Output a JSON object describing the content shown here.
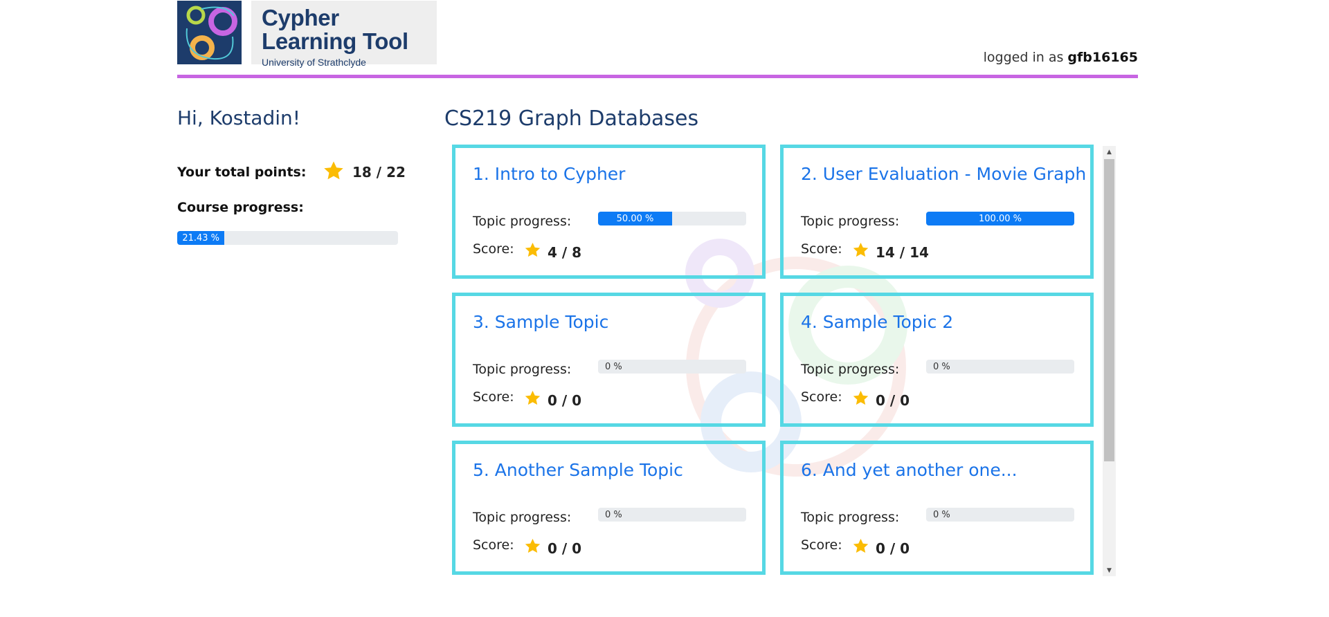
{
  "header": {
    "logo_title_line1": "Cypher",
    "logo_title_line2": "Learning Tool",
    "logo_subtitle": "University of Strathclyde",
    "login_prefix": "logged in as",
    "username": "gfb16165"
  },
  "sidebar": {
    "greeting": "Hi, Kostadin!",
    "points_label": "Your total points:",
    "points_value": "18 / 22",
    "progress_label": "Course progress:",
    "course_progress_percent": 21.43,
    "course_progress_text": "21.43 %"
  },
  "course": {
    "title": "CS219 Graph Databases",
    "topics": [
      {
        "title": "1. Intro to Cypher",
        "progress_label": "Topic progress:",
        "progress_percent": 50,
        "progress_text": "50.00 %",
        "score_label": "Score:",
        "score": "4 / 8"
      },
      {
        "title": "2. User Evaluation - Movie Graph",
        "progress_label": "Topic progress:",
        "progress_percent": 100,
        "progress_text": "100.00 %",
        "score_label": "Score:",
        "score": "14 / 14"
      },
      {
        "title": "3. Sample Topic",
        "progress_label": "Topic progress:",
        "progress_percent": 0,
        "progress_text": "0 %",
        "score_label": "Score:",
        "score": "0 / 0"
      },
      {
        "title": "4. Sample Topic 2",
        "progress_label": "Topic progress:",
        "progress_percent": 0,
        "progress_text": "0 %",
        "score_label": "Score:",
        "score": "0 / 0"
      },
      {
        "title": "5. Another Sample Topic",
        "progress_label": "Topic progress:",
        "progress_percent": 0,
        "progress_text": "0 %",
        "score_label": "Score:",
        "score": "0 / 0"
      },
      {
        "title": "6. And yet another one...",
        "progress_label": "Topic progress:",
        "progress_percent": 0,
        "progress_text": "0 %",
        "score_label": "Score:",
        "score": "0 / 0"
      }
    ]
  },
  "colors": {
    "brand_navy": "#1d3c6b",
    "accent_purple": "#c765e2",
    "card_border": "#56d8e4",
    "link_blue": "#1a73e8",
    "progress_blue": "#0d7bf5",
    "star_gold": "#fbbc04"
  },
  "icons": {
    "logo": "cypher-logo-icon",
    "star": "star-icon",
    "scroll_up": "scroll-up-arrow-icon",
    "scroll_down": "scroll-down-arrow-icon"
  }
}
